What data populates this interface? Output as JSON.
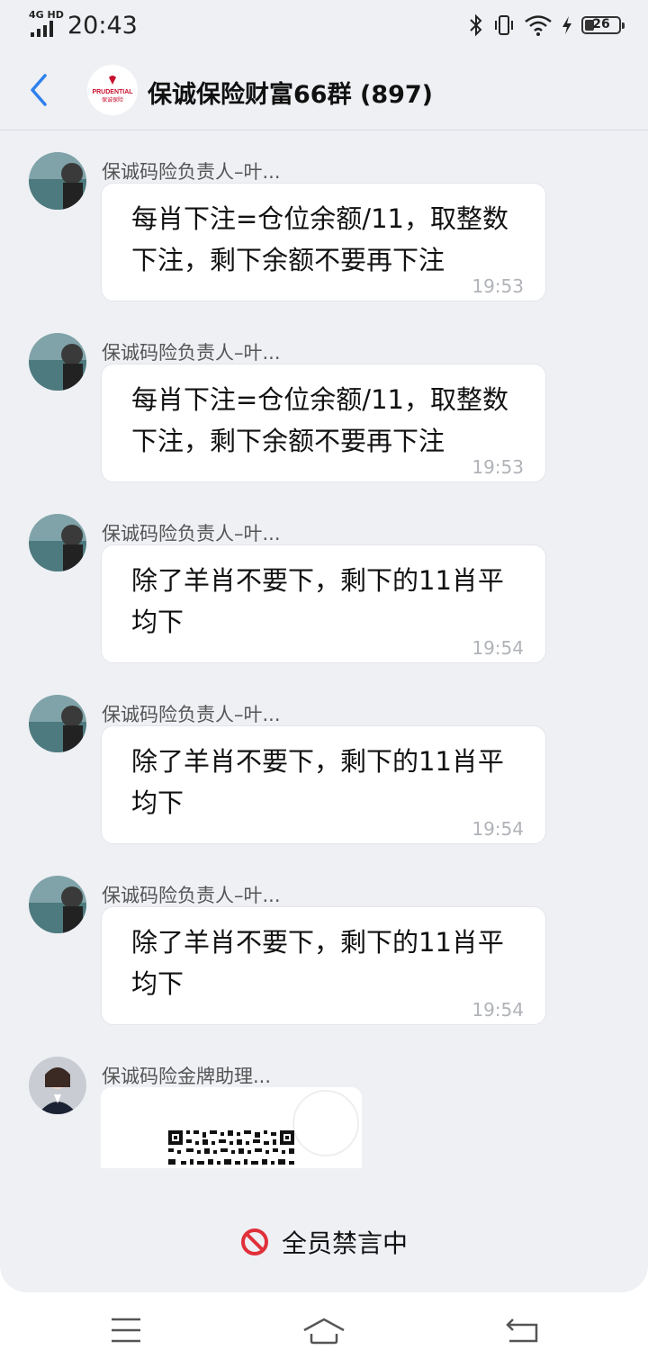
{
  "status_bar": {
    "network": "4G HD",
    "time": "20:43",
    "battery": "26"
  },
  "header": {
    "back_icon": "chevron-left-icon",
    "title": "保诚保险财富66群 (897)",
    "avatar_logo": "PRUDENTIAL 保诚保险"
  },
  "messages": [
    {
      "sender": "保诚码险负责人–叶...",
      "text": "每肖下注=仓位余额/11，取整数下注，剩下余额不要再下注",
      "time": "19:53"
    },
    {
      "sender": "保诚码险负责人–叶...",
      "text": "每肖下注=仓位余额/11，取整数下注，剩下余额不要再下注",
      "time": "19:53"
    },
    {
      "sender": "保诚码险负责人–叶...",
      "text": "除了羊肖不要下，剩下的11肖平均下",
      "time": "19:54"
    },
    {
      "sender": "保诚码险负责人–叶...",
      "text": "除了羊肖不要下，剩下的11肖平均下",
      "time": "19:54"
    },
    {
      "sender": "保诚码险负责人–叶...",
      "text": "除了羊肖不要下，剩下的11肖平均下",
      "time": "19:54"
    }
  ],
  "last_message": {
    "sender": "保诚码险金牌助理...",
    "content": "qr-code-image"
  },
  "muted_notice": {
    "icon": "no-entry-icon",
    "label": "全员禁言中",
    "color": "#e0303a"
  },
  "nav_bar": {
    "menu_icon": "menu-icon",
    "home_icon": "home-icon",
    "back_icon": "back-icon"
  },
  "colors": {
    "accent": "#2f80ed",
    "background": "#eef0f4",
    "bubble": "#ffffff"
  }
}
